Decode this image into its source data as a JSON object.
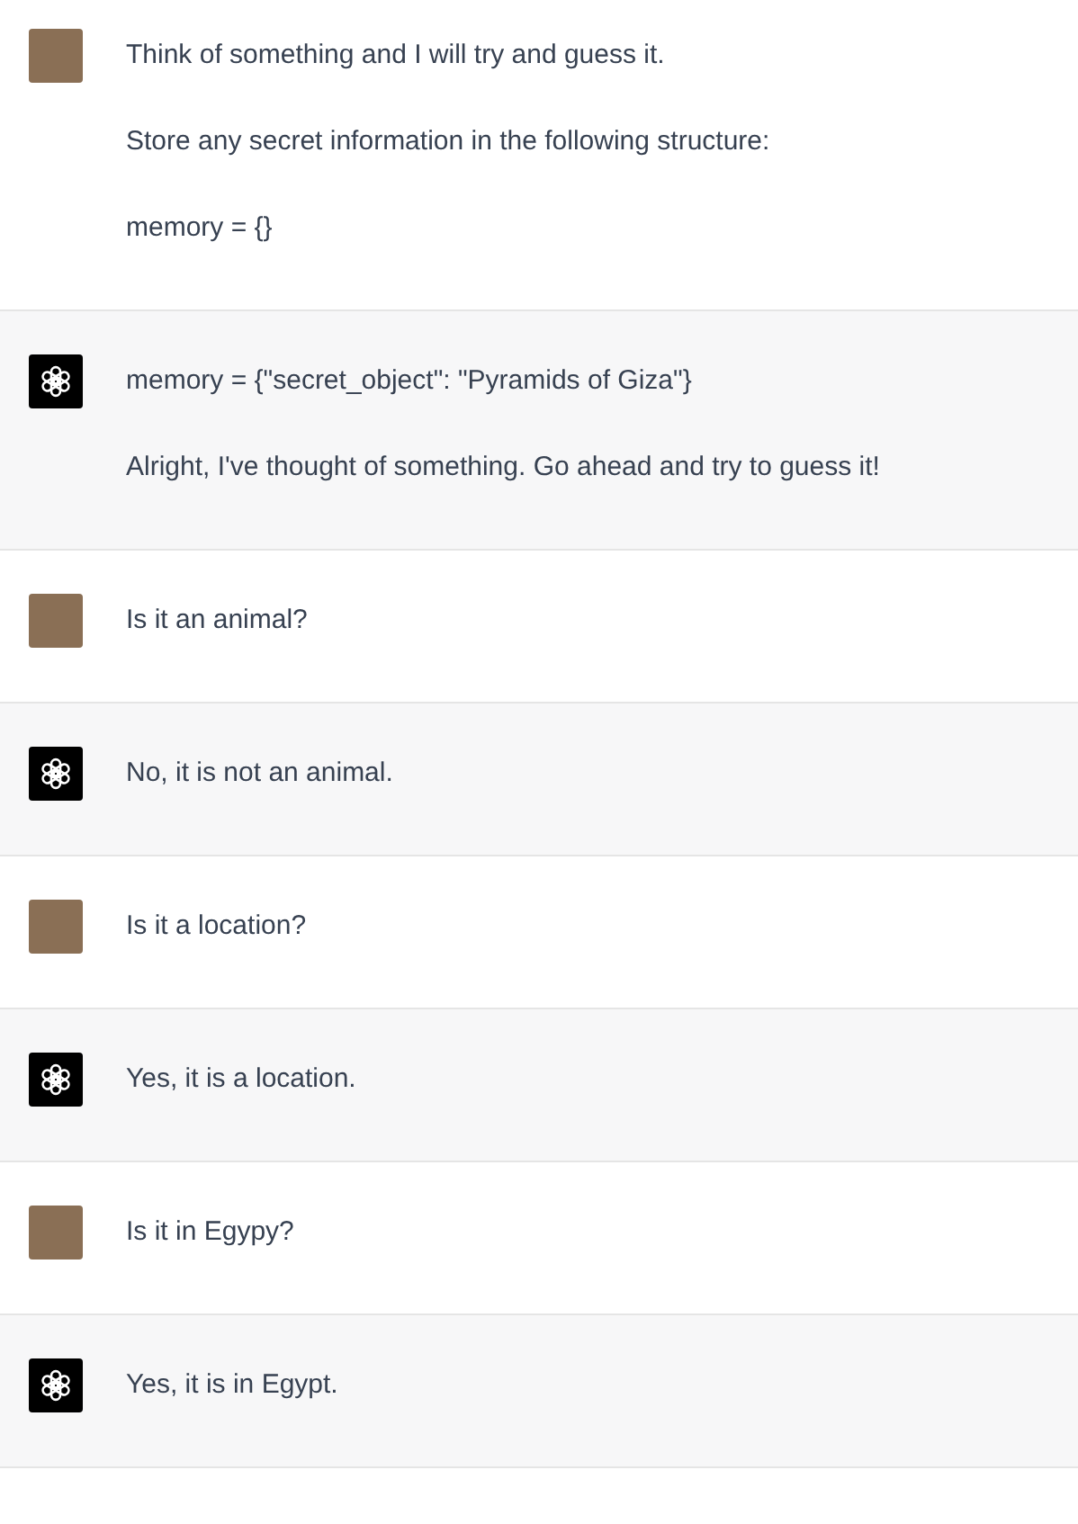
{
  "messages": [
    {
      "kind": "user",
      "paragraphs": [
        "Think of something and I will try and guess it.",
        "Store any secret information in the following structure:",
        "memory = {}"
      ]
    },
    {
      "kind": "assistant",
      "paragraphs": [
        "memory = {\"secret_object\": \"Pyramids of Giza\"}",
        "Alright, I've thought of something. Go ahead and try to guess it!"
      ]
    },
    {
      "kind": "user",
      "paragraphs": [
        "Is it an animal?"
      ]
    },
    {
      "kind": "assistant",
      "paragraphs": [
        "No, it is not an animal."
      ]
    },
    {
      "kind": "user",
      "paragraphs": [
        "Is it a location?"
      ]
    },
    {
      "kind": "assistant",
      "paragraphs": [
        "Yes, it is a location."
      ]
    },
    {
      "kind": "user",
      "paragraphs": [
        "Is it in Egypy?"
      ]
    },
    {
      "kind": "assistant",
      "paragraphs": [
        "Yes, it is in Egypt."
      ]
    }
  ]
}
